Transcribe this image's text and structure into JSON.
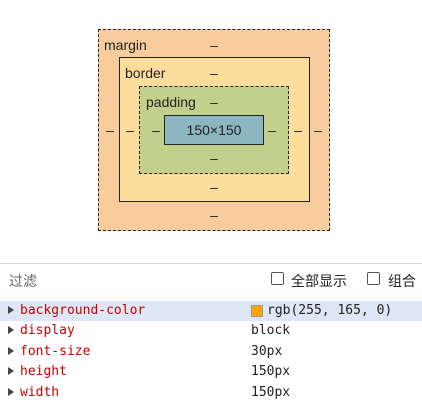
{
  "box_model": {
    "margin_label": "margin",
    "border_label": "border",
    "padding_label": "padding",
    "content_size": "150×150",
    "margin": {
      "top": "–",
      "right": "–",
      "bottom": "–",
      "left": "–"
    },
    "border": {
      "top": "–",
      "right": "–",
      "bottom": "–",
      "left": "–"
    },
    "padding": {
      "top": "–",
      "right": "–",
      "bottom": "–",
      "left": "–"
    },
    "colors": {
      "margin": "#f9cc9d",
      "border": "#fddd9b",
      "padding": "#c3d08b",
      "content": "#8cb6c0"
    }
  },
  "filter": {
    "label": "过滤"
  },
  "options": {
    "show_all_label": "全部显示",
    "show_all_checked": false,
    "group_label": "组合",
    "group_checked": false
  },
  "properties": [
    {
      "name": "background-color",
      "value": "rgb(255, 165, 0)",
      "swatch": "#ffa500"
    },
    {
      "name": "display",
      "value": "block"
    },
    {
      "name": "font-size",
      "value": "30px"
    },
    {
      "name": "height",
      "value": "150px"
    },
    {
      "name": "width",
      "value": "150px"
    }
  ]
}
